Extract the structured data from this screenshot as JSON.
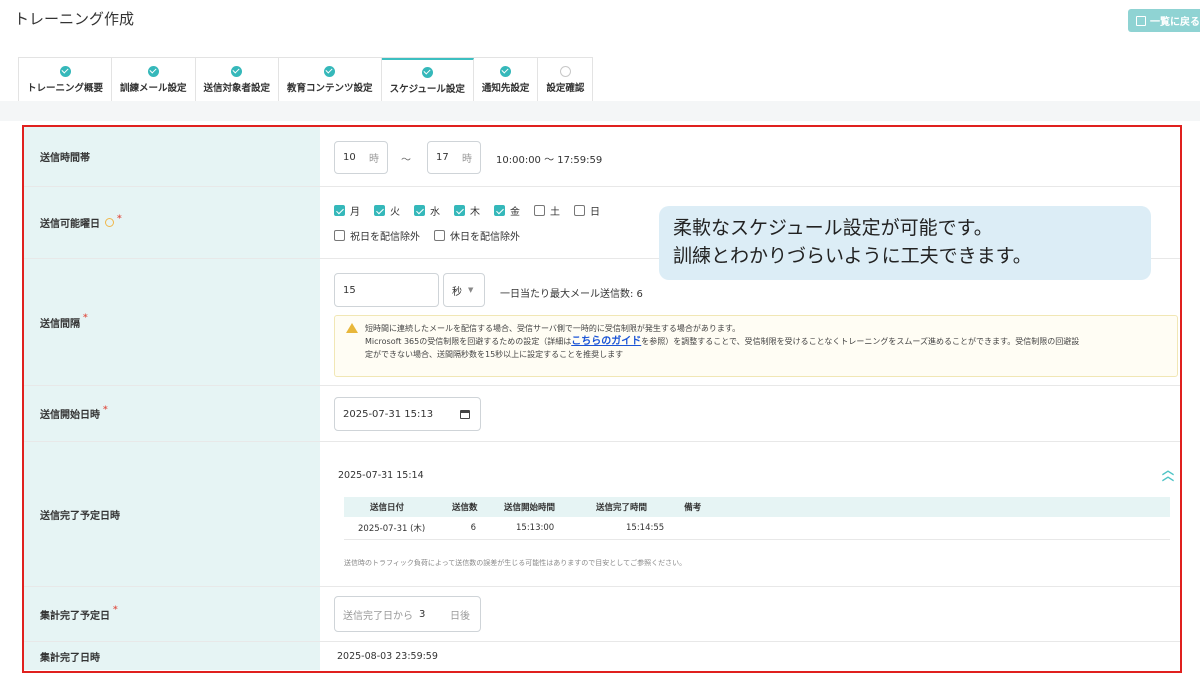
{
  "header": {
    "title": "トレーニング作成",
    "back_label": "一覧に戻る"
  },
  "tabs": [
    {
      "label": "トレーニング概要",
      "status": "done"
    },
    {
      "label": "訓練メール設定",
      "status": "done"
    },
    {
      "label": "送信対象者設定",
      "status": "done"
    },
    {
      "label": "教育コンテンツ設定",
      "status": "done"
    },
    {
      "label": "スケジュール設定",
      "status": "done",
      "active": true
    },
    {
      "label": "通知先設定",
      "status": "done"
    },
    {
      "label": "設定確認",
      "status": "todo"
    }
  ],
  "form": {
    "time_window": {
      "label": "送信時間帯",
      "start": "10",
      "end": "17",
      "unit": "時",
      "tilde": "〜",
      "range_text": "10:00:00 〜 17:59:59"
    },
    "weekdays": {
      "label": "送信可能曜日",
      "days": [
        {
          "label": "月",
          "checked": true
        },
        {
          "label": "火",
          "checked": true
        },
        {
          "label": "水",
          "checked": true
        },
        {
          "label": "木",
          "checked": true
        },
        {
          "label": "金",
          "checked": true
        },
        {
          "label": "土",
          "checked": false
        },
        {
          "label": "日",
          "checked": false
        }
      ],
      "exclusions": [
        {
          "label": "祝日を配信除外",
          "checked": false
        },
        {
          "label": "休日を配信除外",
          "checked": false
        }
      ]
    },
    "interval": {
      "label": "送信間隔",
      "value": "15",
      "unit": "秒",
      "max_per_day": "一日当たり最大メール送信数: 6",
      "notice_line1": "短時間に連続したメールを配信する場合、受信サーバ側で一時的に受信制限が発生する場合があります。",
      "notice_line2_pre": "Microsoft 365の受信制限を回避するための設定（詳細は",
      "notice_link": "こちらのガイド",
      "notice_line2_post": "を参照）を調整することで、受信制限を受けることなくトレーニングをスムーズ進めることができます。受信制限の回避設",
      "notice_line3": "定ができない場合、送間隔秒数を15秒以上に設定することを推奨します"
    },
    "start_datetime": {
      "label": "送信開始日時",
      "value": "2025-07-31 15:13"
    },
    "complete_schedule": {
      "label": "送信完了予定日時",
      "value": "2025-07-31 15:14",
      "columns": [
        "送信日付",
        "送信数",
        "送信開始時間",
        "送信完了時間",
        "備考"
      ],
      "rows": [
        [
          "2025-07-31 (木)",
          "6",
          "15:13:00",
          "15:14:55",
          ""
        ]
      ],
      "note": "送信時のトラフィック負荷によって送信数の誤差が生じる可能性はありますので目安としてご参照ください。"
    },
    "aggregate_days": {
      "label": "集計完了予定日",
      "prefix": "送信完了日から",
      "value": "3",
      "suffix": "日後"
    },
    "aggregate_datetime": {
      "label": "集計完了日時",
      "value": "2025-08-03 23:59:59"
    }
  },
  "callout": {
    "line1": "柔軟なスケジュール設定が可能です。",
    "line2": "訓練とわかりづらいように工夫できます。"
  }
}
